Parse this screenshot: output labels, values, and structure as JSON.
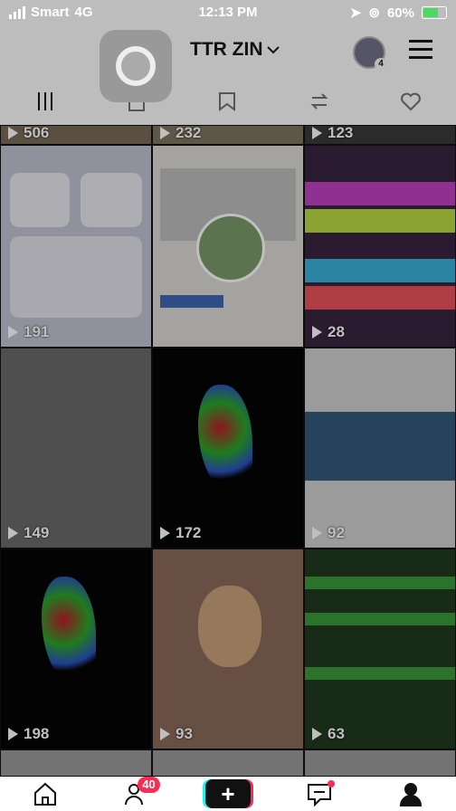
{
  "status_bar": {
    "carrier": "Smart",
    "network": "4G",
    "time": "12:13 PM",
    "battery": "60%"
  },
  "header": {
    "title": "TTR ZIN",
    "notif_count": "4"
  },
  "tabs": [
    {
      "icon": "grid-icon"
    },
    {
      "icon": "lock-icon"
    },
    {
      "icon": "bookmark-icon"
    },
    {
      "icon": "repost-icon"
    },
    {
      "icon": "liked-icon"
    }
  ],
  "videos": [
    {
      "views": "506"
    },
    {
      "views": "232"
    },
    {
      "views": "123"
    },
    {
      "views": "191"
    },
    {
      "views": ""
    },
    {
      "views": "28"
    },
    {
      "views": "149"
    },
    {
      "views": "172"
    },
    {
      "views": "92"
    },
    {
      "views": "198"
    },
    {
      "views": "93"
    },
    {
      "views": "63"
    }
  ],
  "bottom_nav": {
    "inbox_badge": "40",
    "create_label": "+"
  },
  "colors": {
    "accent": "#fe2c55",
    "cyan": "#25f4ee"
  }
}
